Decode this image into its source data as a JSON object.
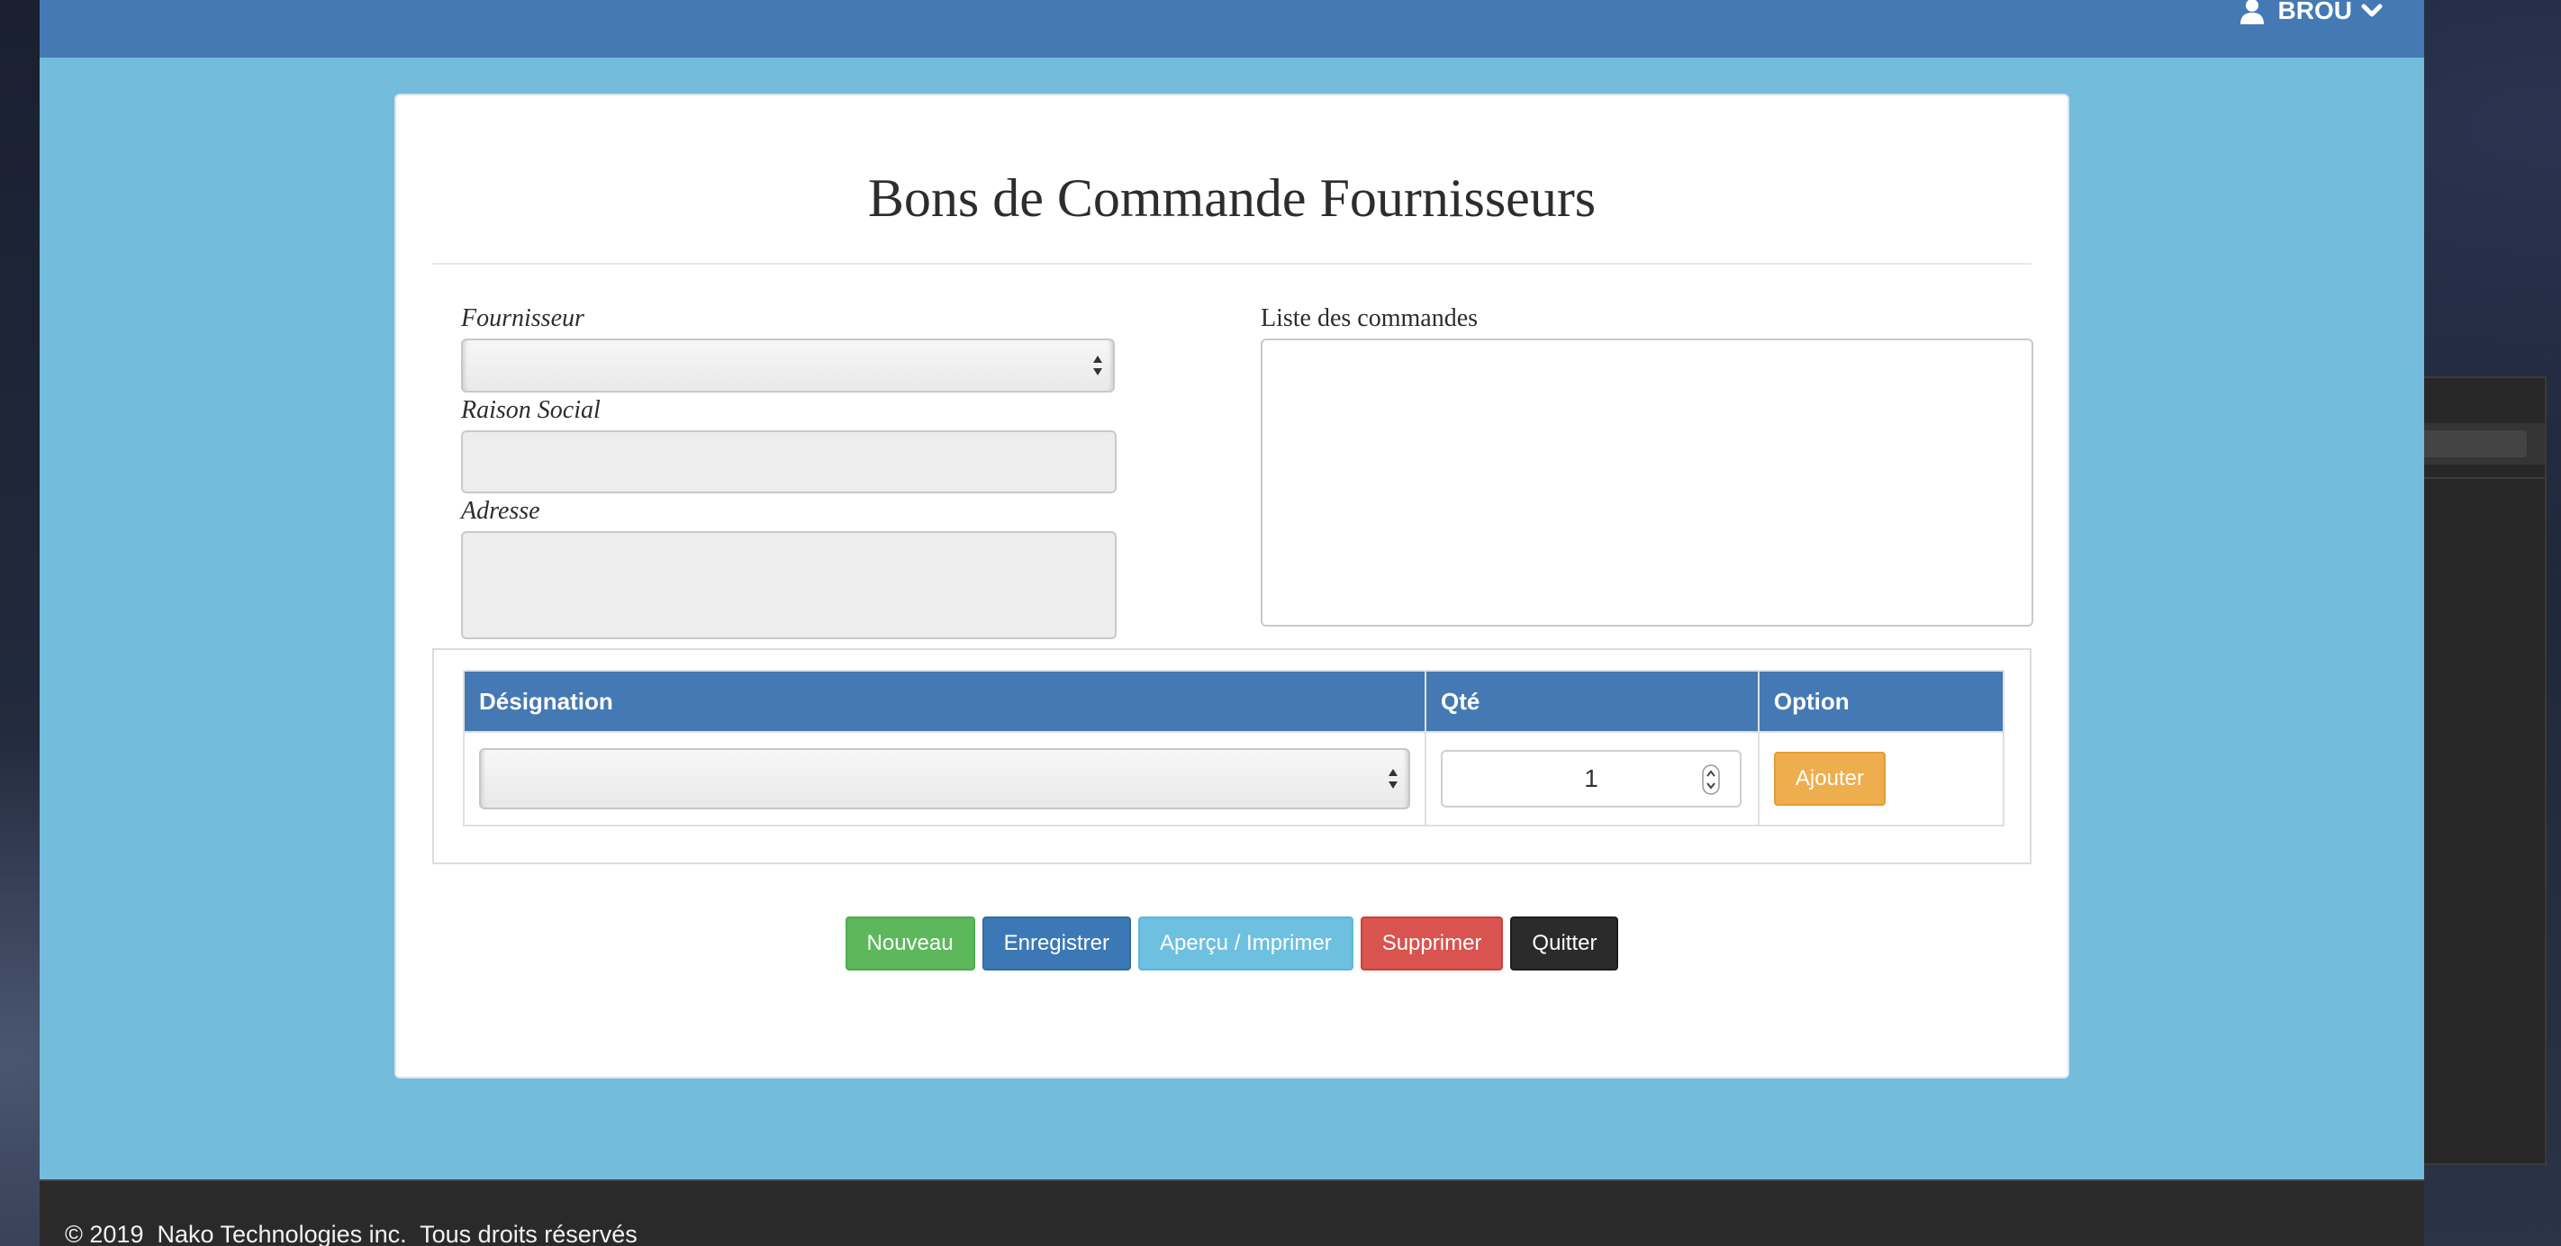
{
  "navbar": {
    "user_name": "BROU",
    "icons": {
      "user": "user-icon",
      "dropdown": "chevron-down-icon"
    }
  },
  "page": {
    "title": "Bons de Commande Fournisseurs"
  },
  "form": {
    "supplier_label": "Fournisseur",
    "supplier_value": "",
    "company_name_label": "Raison Social",
    "company_name_value": "",
    "address_label": "Adresse",
    "address_value": "",
    "orders_list_label": "Liste des commandes"
  },
  "items_table": {
    "headers": [
      "Désignation",
      "Qté",
      "Option"
    ],
    "row": {
      "designation_value": "",
      "quantity": "1",
      "add_label": "Ajouter"
    }
  },
  "actions": {
    "new_label": "Nouveau",
    "save_label": "Enregistrer",
    "preview_print_label": "Aperçu / Imprimer",
    "delete_label": "Supprimer",
    "quit_label": "Quitter"
  },
  "footer": {
    "text": "© 2019  Nako Technologies inc.  Tous droits réservés"
  },
  "colors": {
    "navbar": "#4479b4",
    "page_background": "#73bcdc",
    "table_header": "#4479b4",
    "btn_success": "#5db85c",
    "btn_primary": "#3c78b5",
    "btn_info": "#6ec0e0",
    "btn_danger": "#d9534f",
    "btn_dark": "#2b2b2b",
    "btn_warning": "#efae4e"
  }
}
